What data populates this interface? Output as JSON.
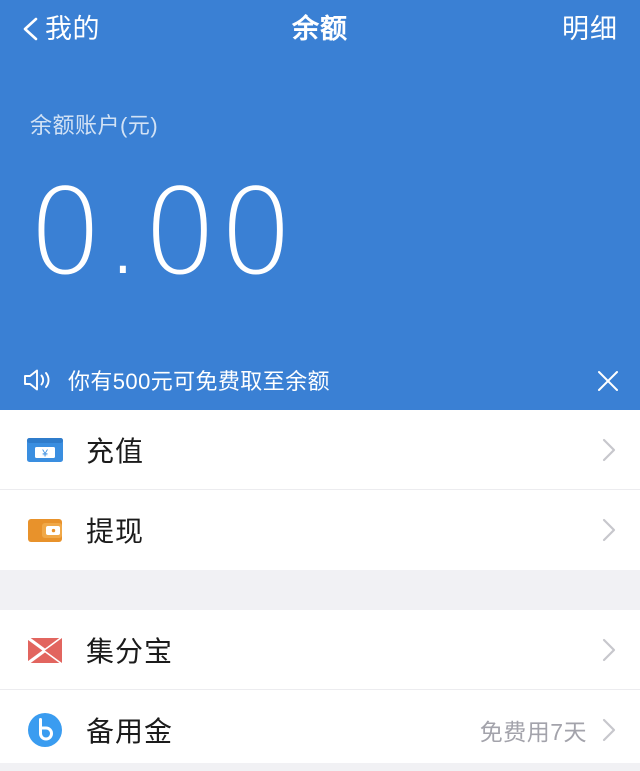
{
  "theme": {
    "accent_blue": "#3a80d4",
    "label_blue": "#d2e2f5",
    "row_text": "#1b1b1b",
    "note_gray": "#a3a3ab",
    "page_gray": "#f1f1f4"
  },
  "navbar": {
    "back_icon": "chevron-left-icon",
    "back_label": "我的",
    "title": "余额",
    "action_label": "明细"
  },
  "balance": {
    "label": "余额账户(元)",
    "amount": "0.00"
  },
  "notice": {
    "speaker_icon": "speaker-icon",
    "text": "你有500元可免费取至余额",
    "close_icon": "close-icon"
  },
  "groups": [
    {
      "rows": [
        {
          "icon": "recharge-card-icon",
          "label": "充值",
          "note": "",
          "chevron": "chevron-right-icon"
        },
        {
          "icon": "withdraw-wallet-icon",
          "label": "提现",
          "note": "",
          "chevron": "chevron-right-icon"
        }
      ]
    },
    {
      "rows": [
        {
          "icon": "jifenbao-icon",
          "label": "集分宝",
          "note": "",
          "chevron": "chevron-right-icon"
        },
        {
          "icon": "beiyongjin-icon",
          "label": "备用金",
          "note": "免费用7天",
          "chevron": "chevron-right-icon"
        }
      ]
    }
  ]
}
